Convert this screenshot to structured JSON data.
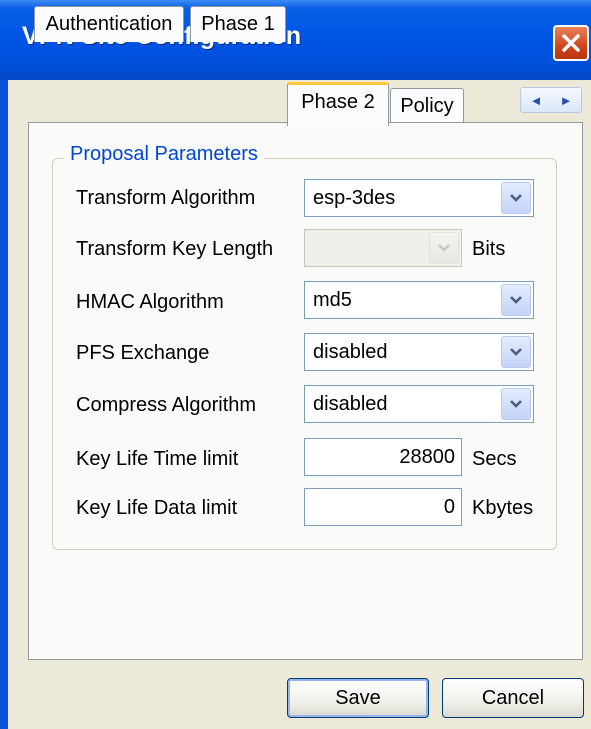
{
  "window": {
    "title": "VPN Site Configuration"
  },
  "tabs": [
    {
      "label": "Authentication"
    },
    {
      "label": "Phase 1"
    },
    {
      "label": "Phase 2"
    },
    {
      "label": "Policy"
    }
  ],
  "active_tab": "Phase 2",
  "tab_scroll": {
    "left": "◄",
    "right": "►"
  },
  "group": {
    "title": "Proposal Parameters",
    "fields": {
      "transform_algorithm": {
        "label": "Transform Algorithm",
        "value": "esp-3des"
      },
      "transform_key_length": {
        "label": "Transform Key Length",
        "value": "",
        "unit": "Bits",
        "enabled": false
      },
      "hmac_algorithm": {
        "label": "HMAC Algorithm",
        "value": "md5"
      },
      "pfs_exchange": {
        "label": "PFS Exchange",
        "value": "disabled"
      },
      "compress_algorithm": {
        "label": "Compress Algorithm",
        "value": "disabled"
      },
      "key_life_time": {
        "label": "Key Life Time limit",
        "value": "28800",
        "unit": "Secs"
      },
      "key_life_data": {
        "label": "Key Life Data limit",
        "value": "0",
        "unit": "Kbytes"
      }
    }
  },
  "buttons": {
    "save": "Save",
    "cancel": "Cancel"
  },
  "colors": {
    "titlebar": "#0055E5",
    "group_title": "#0046D5",
    "active_tab_accent": "#FFC83C",
    "close": "#D0451C"
  },
  "icons": {
    "close": "close-icon",
    "dropdown": "chevron-down-icon"
  }
}
